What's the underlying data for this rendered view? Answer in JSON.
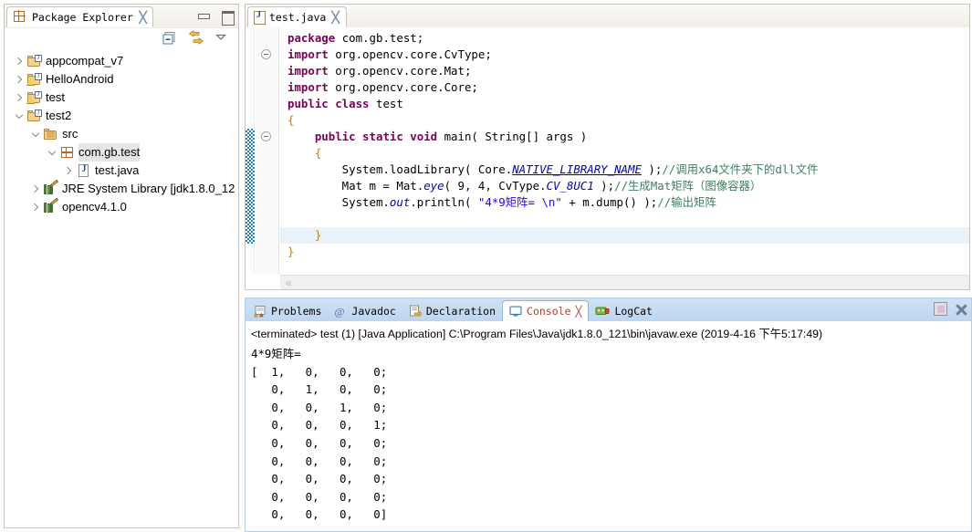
{
  "package_explorer": {
    "tab_label": "Package Explorer",
    "tab_close": "╳",
    "toolbar": {
      "collapse_all": "collapse-all-icon",
      "link_with_editor": "link-with-editor-icon",
      "view_menu": "view-menu-icon",
      "minimize": "minimize-icon",
      "maximize": "maximize-icon"
    },
    "tree": [
      {
        "label": "appcompat_v7",
        "icon": "java-project-icon",
        "indent": 0,
        "state": "collapsed",
        "warn": false,
        "selected": false
      },
      {
        "label": "HelloAndroid",
        "icon": "java-project-icon",
        "indent": 0,
        "state": "collapsed",
        "warn": true,
        "selected": false
      },
      {
        "label": "test",
        "icon": "java-project-icon",
        "indent": 0,
        "state": "collapsed",
        "warn": true,
        "selected": false
      },
      {
        "label": "test2",
        "icon": "java-project-icon",
        "indent": 0,
        "state": "expanded",
        "warn": false,
        "selected": false
      },
      {
        "label": "src",
        "icon": "source-folder-icon",
        "indent": 1,
        "state": "expanded",
        "warn": false,
        "selected": false
      },
      {
        "label": "com.gb.test",
        "icon": "package-icon",
        "indent": 2,
        "state": "expanded",
        "warn": false,
        "selected": true
      },
      {
        "label": "test.java",
        "icon": "java-file-icon",
        "indent": 3,
        "state": "collapsed",
        "warn": false,
        "selected": false
      },
      {
        "label": "JRE System Library [jdk1.8.0_12",
        "icon": "library-icon",
        "indent": 1,
        "state": "collapsed",
        "warn": false,
        "selected": false
      },
      {
        "label": "opencv4.1.0",
        "icon": "library-icon",
        "indent": 1,
        "state": "collapsed",
        "warn": false,
        "selected": false
      }
    ]
  },
  "editor": {
    "tab_label": "test.java",
    "tab_close": "╳",
    "file_icon": "java-file-icon",
    "scroll_left_chevron": "«",
    "code_lines": [
      {
        "indent": 1,
        "highlight": false,
        "parts": [
          {
            "t": "package ",
            "c": "kw"
          },
          {
            "t": "com.gb.test;",
            "c": ""
          }
        ]
      },
      {
        "indent": 1,
        "highlight": false,
        "fold": true,
        "parts": [
          {
            "t": "import ",
            "c": "kw"
          },
          {
            "t": "org.opencv.core.CvType;",
            "c": ""
          }
        ]
      },
      {
        "indent": 1,
        "highlight": false,
        "parts": [
          {
            "t": "import ",
            "c": "kw"
          },
          {
            "t": "org.opencv.core.Mat;",
            "c": ""
          }
        ]
      },
      {
        "indent": 1,
        "highlight": false,
        "parts": [
          {
            "t": "import ",
            "c": "kw"
          },
          {
            "t": "org.opencv.core.Core;",
            "c": ""
          }
        ]
      },
      {
        "indent": 1,
        "highlight": false,
        "parts": [
          {
            "t": "public class ",
            "c": "kw"
          },
          {
            "t": "test",
            "c": ""
          }
        ]
      },
      {
        "indent": 1,
        "highlight": false,
        "parts": [
          {
            "t": "{",
            "c": "brace"
          }
        ]
      },
      {
        "indent": 2,
        "highlight": false,
        "fold": true,
        "parts": [
          {
            "t": "public static void ",
            "c": "kw"
          },
          {
            "t": "main( String[] args )",
            "c": ""
          }
        ]
      },
      {
        "indent": 2,
        "highlight": false,
        "parts": [
          {
            "t": "{",
            "c": "brace"
          }
        ]
      },
      {
        "indent": 3,
        "highlight": false,
        "parts": [
          {
            "t": "System.loadLibrary( Core.",
            "c": ""
          },
          {
            "t": "NATIVE_LIBRARY_NAME",
            "c": "sfld"
          },
          {
            "t": " );",
            "c": ""
          },
          {
            "t": "//调用x64文件夹下的dll文件",
            "c": "cmt"
          }
        ]
      },
      {
        "indent": 3,
        "highlight": false,
        "parts": [
          {
            "t": "Mat m = Mat.",
            "c": ""
          },
          {
            "t": "eye",
            "c": "fld"
          },
          {
            "t": "( 9, 4, CvType.",
            "c": ""
          },
          {
            "t": "CV_8UC1",
            "c": "fld"
          },
          {
            "t": " );",
            "c": ""
          },
          {
            "t": "//生成Mat矩阵（图像容器）",
            "c": "cmt"
          }
        ]
      },
      {
        "indent": 3,
        "highlight": false,
        "parts": [
          {
            "t": "System.",
            "c": ""
          },
          {
            "t": "out",
            "c": "fld"
          },
          {
            "t": ".println( ",
            "c": ""
          },
          {
            "t": "\"4*9矩阵= \\n\"",
            "c": "str"
          },
          {
            "t": " + m.dump() );",
            "c": ""
          },
          {
            "t": "//输出矩阵",
            "c": "cmt"
          }
        ]
      },
      {
        "indent": 0,
        "highlight": false,
        "parts": [
          {
            "t": "",
            "c": ""
          }
        ]
      },
      {
        "indent": 2,
        "highlight": true,
        "parts": [
          {
            "t": "}",
            "c": "brace"
          }
        ]
      },
      {
        "indent": 1,
        "highlight": false,
        "parts": [
          {
            "t": "}",
            "c": "brace"
          }
        ]
      }
    ]
  },
  "console_panel": {
    "tabs": [
      {
        "label": "Problems",
        "icon": "problems-icon",
        "active": false,
        "close": ""
      },
      {
        "label": "Javadoc",
        "icon": "javadoc-icon",
        "active": false,
        "close": ""
      },
      {
        "label": "Declaration",
        "icon": "declaration-icon",
        "active": false,
        "close": ""
      },
      {
        "label": "Console",
        "icon": "console-icon",
        "active": true,
        "close": "╳"
      },
      {
        "label": "LogCat",
        "icon": "logcat-icon",
        "active": false,
        "close": ""
      }
    ],
    "buttons": {
      "terminate": "terminate-icon",
      "close": "close-icon"
    },
    "launch_line": "<terminated> test (1) [Java Application] C:\\Program Files\\Java\\jdk1.8.0_121\\bin\\javaw.exe (2019-4-16 下午5:17:49)",
    "output": "4*9矩阵=\n[  1,   0,   0,   0;\n   0,   1,   0,   0;\n   0,   0,   1,   0;\n   0,   0,   0,   1;\n   0,   0,   0,   0;\n   0,   0,   0,   0;\n   0,   0,   0,   0;\n   0,   0,   0,   0;\n   0,   0,   0,   0]"
  }
}
